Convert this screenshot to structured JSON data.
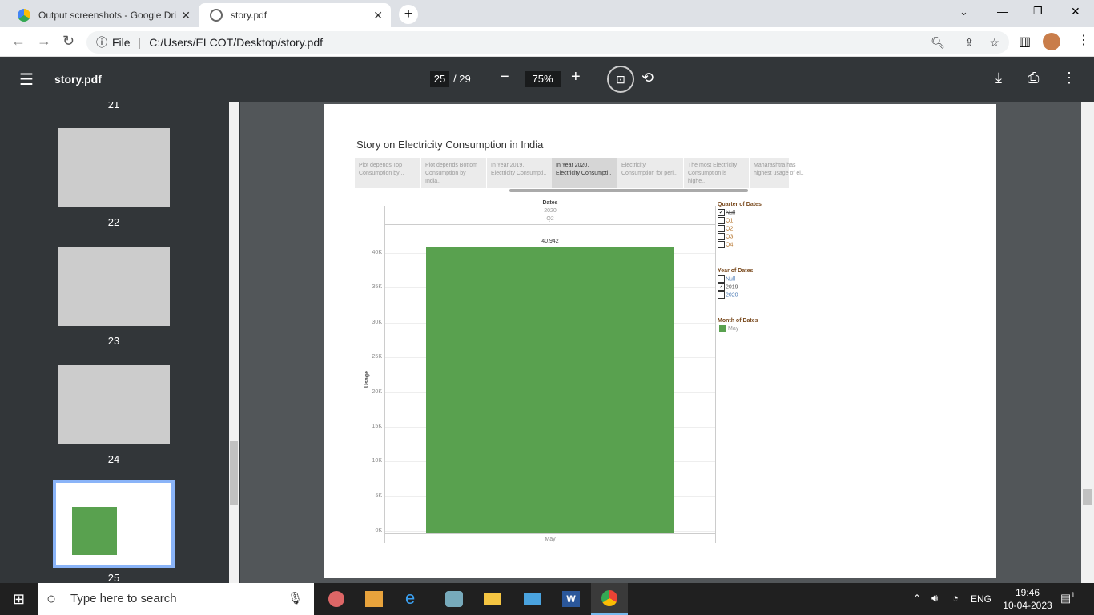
{
  "browser": {
    "tabs": [
      {
        "title": "Output screenshots - Google Dri"
      },
      {
        "title": "story.pdf"
      }
    ],
    "file_label": "File",
    "url": "C:/Users/ELCOT/Desktop/story.pdf"
  },
  "pdf": {
    "title": "story.pdf",
    "page": "25",
    "page_total": "/ 29",
    "zoom": "75%"
  },
  "thumbs": {
    "labels": [
      "21",
      "22",
      "23",
      "24",
      "25"
    ]
  },
  "story": {
    "title": "Story on Electricity Consumption in India",
    "points": [
      {
        "l1": "Plot depends Top",
        "l2": "Consumption by .."
      },
      {
        "l1": "Plot depends Bottom",
        "l2": "Consumption by India.."
      },
      {
        "l1": "In Year 2019,",
        "l2": "Electricity Consumpti.."
      },
      {
        "l1": "In Year 2020,",
        "l2": "Electricity Consumpti.."
      },
      {
        "l1": "Electricity",
        "l2": "Consumption for peri.."
      },
      {
        "l1": "The most Electricity",
        "l2": "Consumption is highe.."
      },
      {
        "l1": "Maharashtra has",
        "l2": "highest usage of el.."
      }
    ],
    "active_point": 3
  },
  "chart_data": {
    "type": "bar",
    "header": "Dates",
    "header_year": "2020",
    "header_quarter": "Q2",
    "categories": [
      "May"
    ],
    "values": [
      40942
    ],
    "data_labels": [
      "40,942"
    ],
    "ylabel": "Usage",
    "ylim": [
      0,
      40000
    ],
    "yticks": [
      "0K",
      "5K",
      "10K",
      "15K",
      "20K",
      "25K",
      "30K",
      "35K",
      "40K"
    ],
    "color": "#59a14f",
    "grid": true
  },
  "filters": {
    "quarter": {
      "title": "Quarter of Dates",
      "items": [
        {
          "label": "Null",
          "checked": true
        },
        {
          "label": "Q1",
          "checked": false
        },
        {
          "label": "Q2",
          "checked": false
        },
        {
          "label": "Q3",
          "checked": false
        },
        {
          "label": "Q4",
          "checked": false
        }
      ]
    },
    "year": {
      "title": "Year of Dates",
      "items": [
        {
          "label": "Null",
          "checked": false
        },
        {
          "label": "2019",
          "checked": true
        },
        {
          "label": "2020",
          "checked": false
        }
      ]
    },
    "month": {
      "title": "Month of Dates",
      "items": [
        {
          "label": "May"
        }
      ]
    }
  },
  "taskbar": {
    "search": "Type here to search",
    "lang": "ENG",
    "time": "19:46",
    "date": "10-04-2023",
    "notif": "1"
  }
}
